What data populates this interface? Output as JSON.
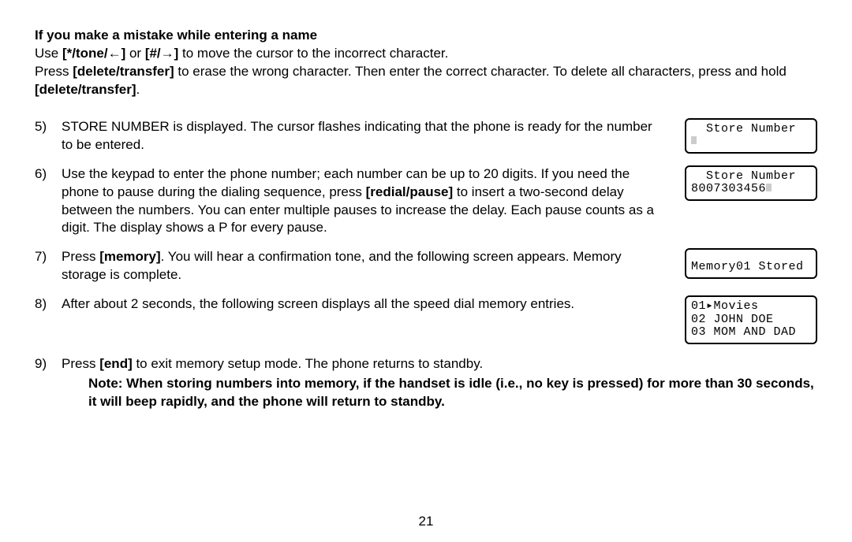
{
  "intro": {
    "heading": "If you make a mistake while entering a name",
    "line1a": "Use ",
    "key_left": "[*/tone/←]",
    "line1b": " or ",
    "key_right": "[#/→]",
    "line1c": " to move the cursor to the incorrect character.",
    "line2a": "Press ",
    "key_deltrans": "[delete/transfer]",
    "line2b": " to erase the wrong character. Then enter the correct character. To delete all characters, press and hold ",
    "key_deltrans2": "[delete/transfer]",
    "line2c": "."
  },
  "steps": {
    "s5": {
      "num": "5)",
      "text": "STORE NUMBER is displayed. The cursor flashes indicating that the phone is ready for the number to be entered.",
      "lcd_top": "Store Number"
    },
    "s6": {
      "num": "6)",
      "text_a": "Use the keypad to enter the phone number; each number can be up to 20 digits. If you need the phone to pause during the dialing sequence, press ",
      "key_redial": "[redial/pause]",
      "text_b": " to insert a two-second delay between the numbers. You can enter multiple pauses to increase the delay. Each pause counts as a digit. The display shows a P for every pause.",
      "lcd_top": "Store Number",
      "lcd_line2": "8007303456"
    },
    "s7": {
      "num": "7)",
      "text_a": "Press ",
      "key_memory": "[memory]",
      "text_b": ". You will hear a confirmation tone, and the following screen appears. Memory storage is complete.",
      "lcd_line": "Memory01 Stored"
    },
    "s8": {
      "num": "8)",
      "text": "After about 2 seconds, the following screen displays all the speed dial memory entries.",
      "lcd_l1": "01▸Movies",
      "lcd_l2": "02 JOHN DOE",
      "lcd_l3": "03 MOM AND DAD"
    },
    "s9": {
      "num": "9)",
      "text_a": "Press ",
      "key_end": "[end]",
      "text_b": " to exit memory setup mode. The phone returns to standby."
    }
  },
  "note": {
    "text": "Note: When storing numbers into memory, if the handset is idle (i.e., no key is pressed) for more than 30 seconds, it will beep rapidly, and the phone will return to standby."
  },
  "page_number": "21"
}
